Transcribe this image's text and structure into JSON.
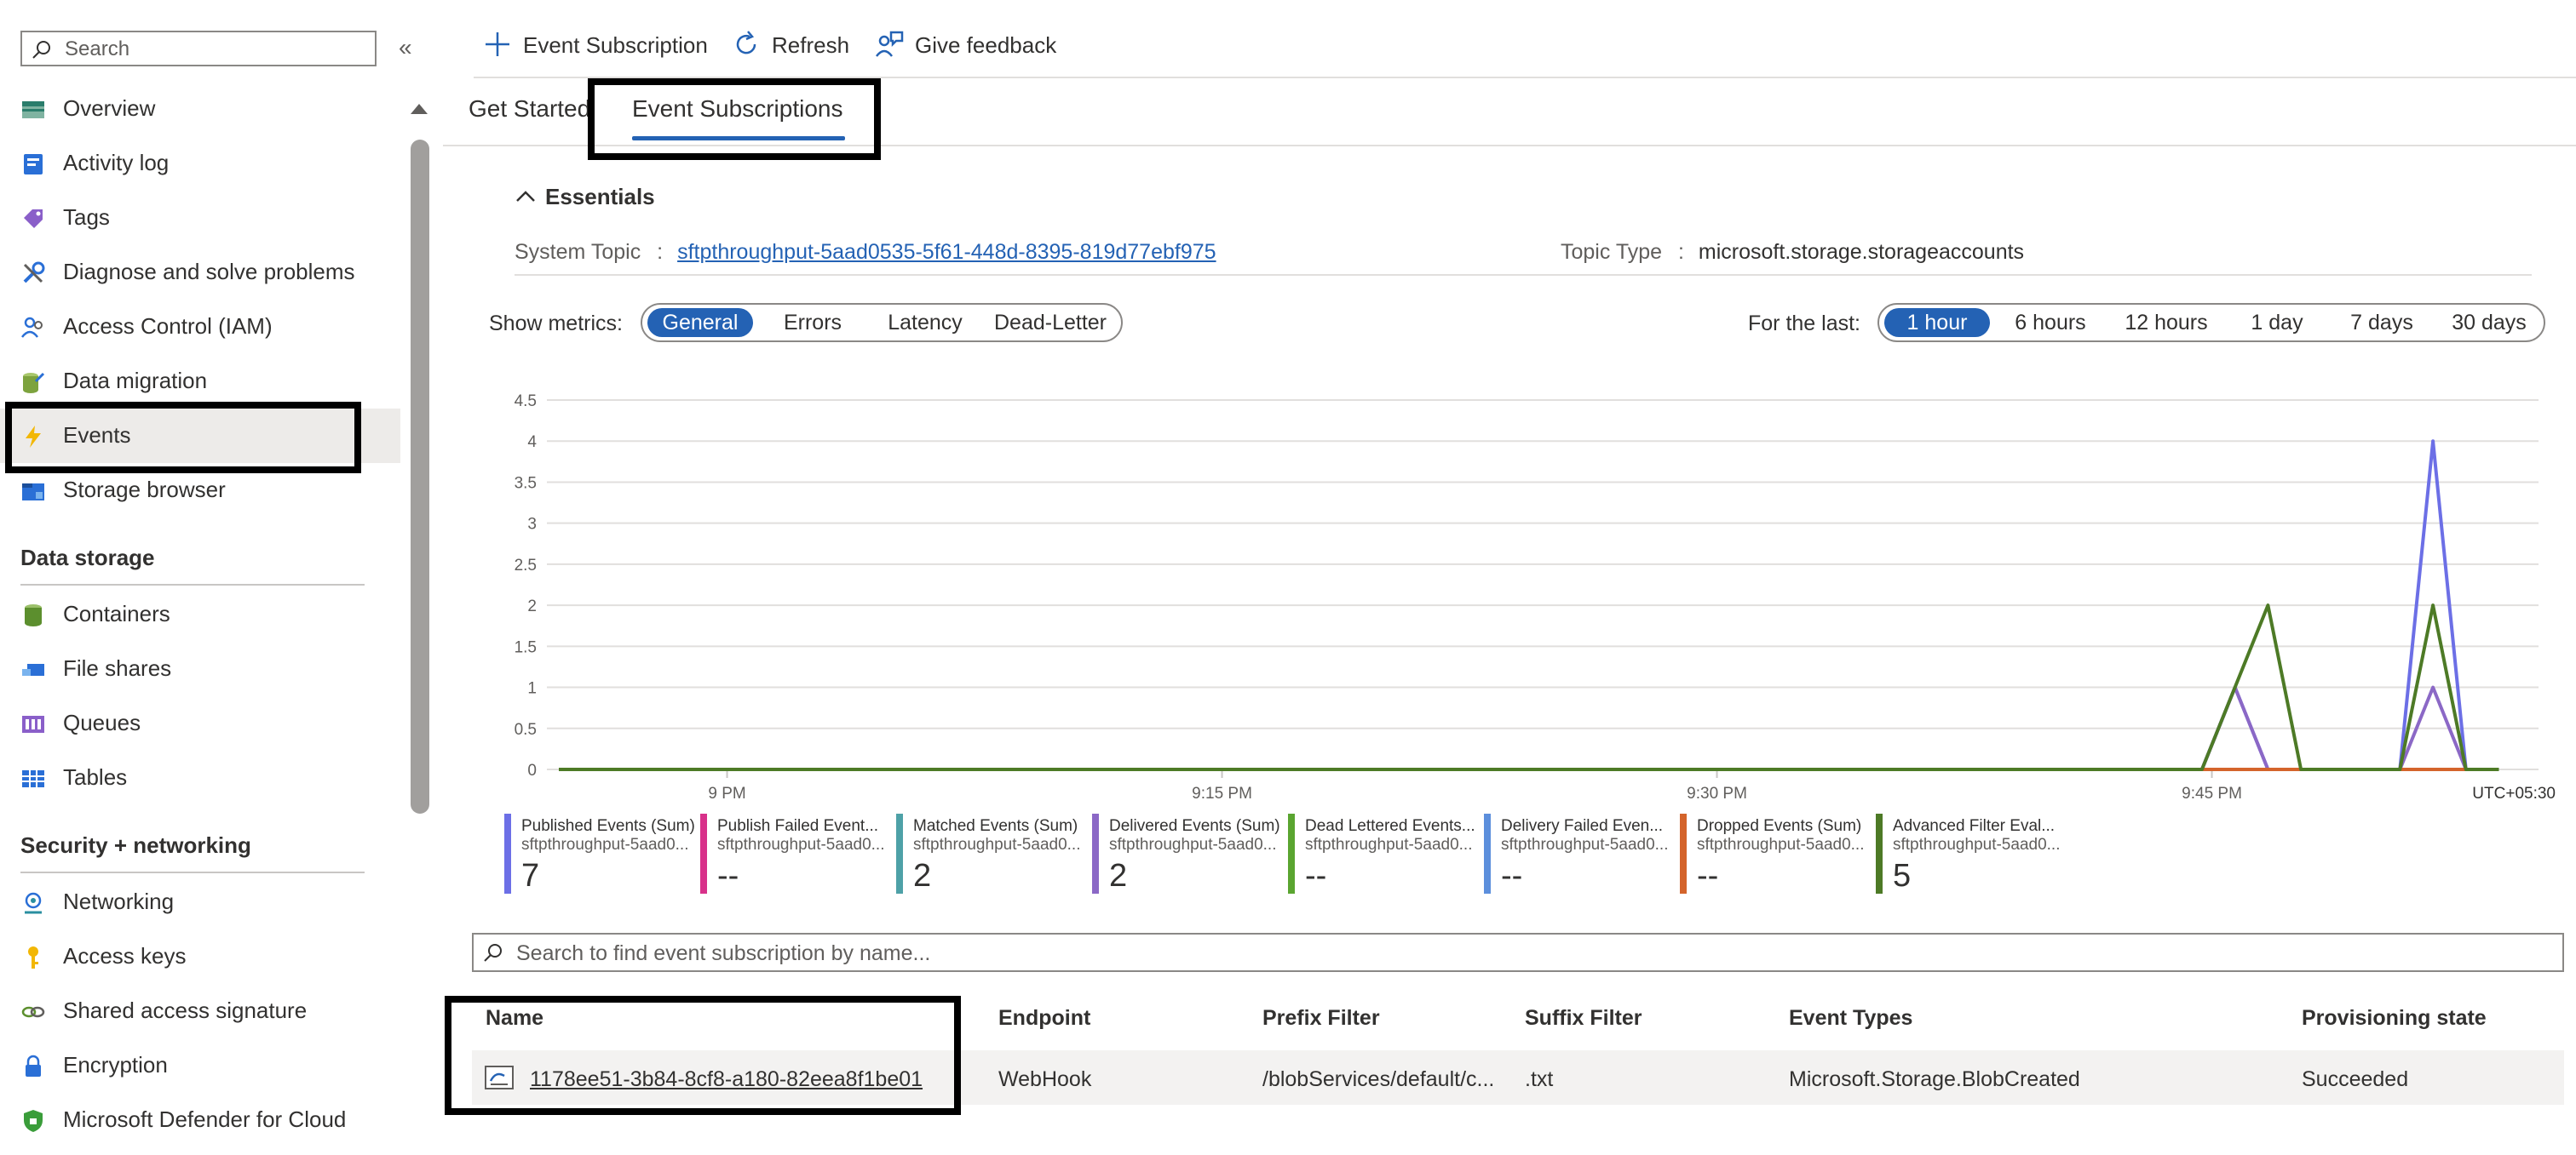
{
  "sidebar": {
    "search_placeholder": "Search",
    "collapse_glyph": "«",
    "items": [
      {
        "label": "Overview",
        "icon": "overview-icon"
      },
      {
        "label": "Activity log",
        "icon": "activity-log-icon"
      },
      {
        "label": "Tags",
        "icon": "tag-icon"
      },
      {
        "label": "Diagnose and solve problems",
        "icon": "wrench-icon"
      },
      {
        "label": "Access Control (IAM)",
        "icon": "people-icon"
      },
      {
        "label": "Data migration",
        "icon": "data-migration-icon"
      },
      {
        "label": "Events",
        "icon": "lightning-icon",
        "selected": true
      },
      {
        "label": "Storage browser",
        "icon": "storage-browser-icon"
      }
    ],
    "sections": [
      {
        "title": "Data storage",
        "items": [
          {
            "label": "Containers",
            "icon": "containers-icon"
          },
          {
            "label": "File shares",
            "icon": "file-shares-icon"
          },
          {
            "label": "Queues",
            "icon": "queues-icon"
          },
          {
            "label": "Tables",
            "icon": "tables-icon"
          }
        ]
      },
      {
        "title": "Security + networking",
        "items": [
          {
            "label": "Networking",
            "icon": "networking-icon"
          },
          {
            "label": "Access keys",
            "icon": "key-icon"
          },
          {
            "label": "Shared access signature",
            "icon": "link-icon"
          },
          {
            "label": "Encryption",
            "icon": "lock-icon"
          },
          {
            "label": "Microsoft Defender for Cloud",
            "icon": "shield-icon"
          }
        ]
      }
    ]
  },
  "toolbar": {
    "add_label": "Event Subscription",
    "refresh_label": "Refresh",
    "feedback_label": "Give feedback"
  },
  "tabs": [
    {
      "label": "Get Started",
      "active": false
    },
    {
      "label": "Event Subscriptions",
      "active": true
    }
  ],
  "essentials": {
    "title": "Essentials",
    "system_topic_label": "System Topic",
    "system_topic_value": "sftpthroughput-5aad0535-5f61-448d-8395-819d77ebf975",
    "topic_type_label": "Topic Type",
    "topic_type_value": "microsoft.storage.storageaccounts",
    "separator": ":"
  },
  "metrics": {
    "label": "Show metrics:",
    "options": [
      "General",
      "Errors",
      "Latency",
      "Dead-Letter"
    ],
    "selected": "General"
  },
  "time_range": {
    "label": "For the last:",
    "options": [
      "1 hour",
      "6 hours",
      "12 hours",
      "1 day",
      "7 days",
      "30 days"
    ],
    "selected": "1 hour"
  },
  "chart_data": {
    "type": "line",
    "title": "",
    "xlabel": "",
    "ylabel": "",
    "ylim": [
      0,
      4.5
    ],
    "yticks": [
      "0",
      "0.5",
      "1",
      "1.5",
      "2",
      "2.5",
      "3",
      "3.5",
      "4",
      "4.5"
    ],
    "xlim": [
      0,
      60
    ],
    "xticks": [
      {
        "x": 5.1,
        "label": "9 PM"
      },
      {
        "x": 20.1,
        "label": "9:15 PM"
      },
      {
        "x": 35.1,
        "label": "9:30 PM"
      },
      {
        "x": 50.1,
        "label": "9:45 PM"
      }
    ],
    "timezone": "UTC+05:30",
    "grid": true,
    "series": [
      {
        "name": "Published Events (Sum)",
        "color": "#6c6fe6",
        "points": [
          [
            0,
            0
          ],
          [
            49.8,
            0
          ],
          [
            50.8,
            1
          ],
          [
            51.8,
            0
          ],
          [
            55.8,
            0
          ],
          [
            56.8,
            4
          ],
          [
            57.8,
            0
          ],
          [
            58.8,
            0
          ]
        ]
      },
      {
        "name": "Delivered Events (Sum)",
        "color": "#8b68c6",
        "points": [
          [
            0,
            0
          ],
          [
            49.8,
            0
          ],
          [
            50.8,
            1
          ],
          [
            51.8,
            0
          ],
          [
            55.8,
            0
          ],
          [
            56.8,
            1
          ],
          [
            57.8,
            0
          ],
          [
            58.8,
            0
          ]
        ]
      },
      {
        "name": "Dropped Events (Sum)",
        "color": "#d4642b",
        "points": [
          [
            49.8,
            0
          ],
          [
            52.8,
            0
          ],
          [
            55.8,
            0
          ],
          [
            57.8,
            0
          ]
        ]
      },
      {
        "name": "Advanced Filter Eval...",
        "color": "#4d7a26",
        "points": [
          [
            0,
            0
          ],
          [
            49.8,
            0
          ],
          [
            51.8,
            2
          ],
          [
            52.8,
            0
          ],
          [
            55.8,
            0
          ],
          [
            56.8,
            2
          ],
          [
            57.8,
            0
          ],
          [
            58.8,
            0
          ]
        ]
      }
    ]
  },
  "legend": [
    {
      "name": "Published Events (Sum)",
      "resource": "sftpthroughput-5aad0...",
      "value": "7",
      "color": "#6c6fe6"
    },
    {
      "name": "Publish Failed Event...",
      "resource": "sftpthroughput-5aad0...",
      "value": "--",
      "color": "#d8318a"
    },
    {
      "name": "Matched Events (Sum)",
      "resource": "sftpthroughput-5aad0...",
      "value": "2",
      "color": "#4ea1a7"
    },
    {
      "name": "Delivered Events (Sum)",
      "resource": "sftpthroughput-5aad0...",
      "value": "2",
      "color": "#8b68c6"
    },
    {
      "name": "Dead Lettered Events...",
      "resource": "sftpthroughput-5aad0...",
      "value": "--",
      "color": "#5aa530"
    },
    {
      "name": "Delivery Failed Even...",
      "resource": "sftpthroughput-5aad0...",
      "value": "--",
      "color": "#5c8fdc"
    },
    {
      "name": "Dropped Events (Sum)",
      "resource": "sftpthroughput-5aad0...",
      "value": "--",
      "color": "#d4642b"
    },
    {
      "name": "Advanced Filter Eval...",
      "resource": "sftpthroughput-5aad0...",
      "value": "5",
      "color": "#4d7a26"
    }
  ],
  "subscriptions": {
    "search_placeholder": "Search to find event subscription by name...",
    "columns": [
      "Name",
      "Endpoint",
      "Prefix Filter",
      "Suffix Filter",
      "Event Types",
      "Provisioning state"
    ],
    "rows": [
      {
        "name": "1178ee51-3b84-8cf8-a180-82eea8f1be01",
        "endpoint": "WebHook",
        "prefix": "/blobServices/default/c...",
        "suffix": ".txt",
        "event_types": "Microsoft.Storage.BlobCreated",
        "state": "Succeeded"
      }
    ]
  },
  "colors": {
    "accent": "#2462b4",
    "highlight_box": "#000000",
    "selected_bg": "#edebe9"
  }
}
